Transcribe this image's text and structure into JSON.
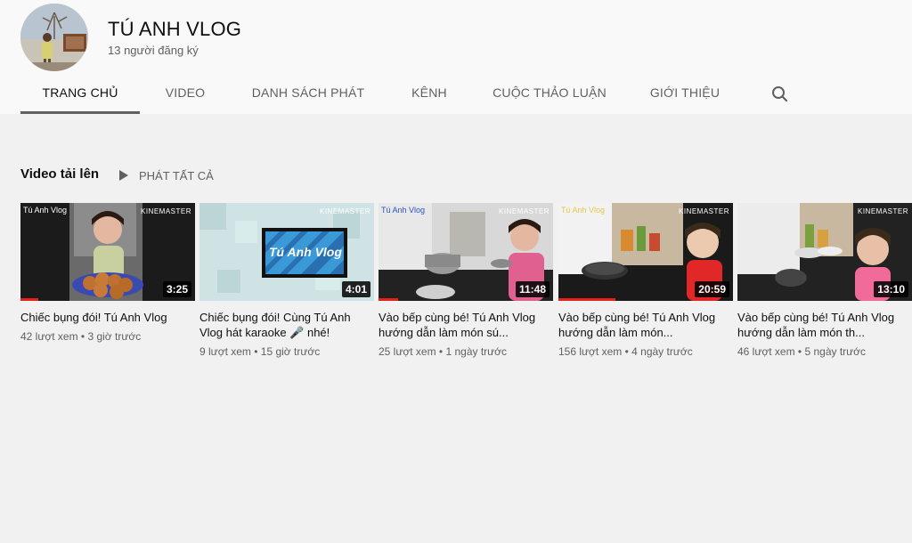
{
  "channel": {
    "name": "TÚ ANH VLOG",
    "subscribers": "13 người đăng ký"
  },
  "tabs": [
    {
      "label": "TRANG CHỦ"
    },
    {
      "label": "VIDEO"
    },
    {
      "label": "DANH SÁCH PHÁT"
    },
    {
      "label": "KÊNH"
    },
    {
      "label": "CUỘC THẢO LUẬN"
    },
    {
      "label": "GIỚI THIỆU"
    }
  ],
  "uploads": {
    "title": "Video tải lên",
    "play_all": "PHÁT TẤT CẢ"
  },
  "videos": [
    {
      "title": "Chiếc bụng đói! Tú Anh Vlog",
      "meta": "42 lượt xem • 3 giờ trước",
      "duration": "3:25",
      "watermark": "Tú Anh Vlog",
      "kinemaster": "KINEMASTER"
    },
    {
      "title": "Chiếc bụng đói! Cùng Tú Anh Vlog hát karaoke 🎤 nhé!",
      "meta": "9 lượt xem • 15 giờ trước",
      "duration": "4:01",
      "watermark": "",
      "kinemaster": "KINEMASTER",
      "banner": "Tú Anh Vlog"
    },
    {
      "title": "Vào bếp cùng bé! Tú Anh Vlog hướng dẫn làm món sú...",
      "meta": "25 lượt xem • 1 ngày trước",
      "duration": "11:48",
      "watermark": "Tú Anh Vlog",
      "kinemaster": "KINEMASTER"
    },
    {
      "title": "Vào bếp cùng bé! Tú Anh Vlog hướng dẫn làm món...",
      "meta": "156 lượt xem • 4 ngày trước",
      "duration": "20:59",
      "watermark": "Tú Anh Vlog",
      "kinemaster": "KINEMASTER"
    },
    {
      "title": "Vào bếp cùng bé! Tú Anh Vlog hướng dẫn làm món th...",
      "meta": "46 lượt xem • 5 ngày trước",
      "duration": "13:10",
      "watermark": "",
      "kinemaster": "KINEMASTER"
    }
  ],
  "colors": {
    "page_bg": "#f1f1f1",
    "header_bg": "#f9f9f9",
    "progress": "#e62117"
  },
  "icons": {
    "search": "search-icon",
    "play_all": "play-icon"
  }
}
